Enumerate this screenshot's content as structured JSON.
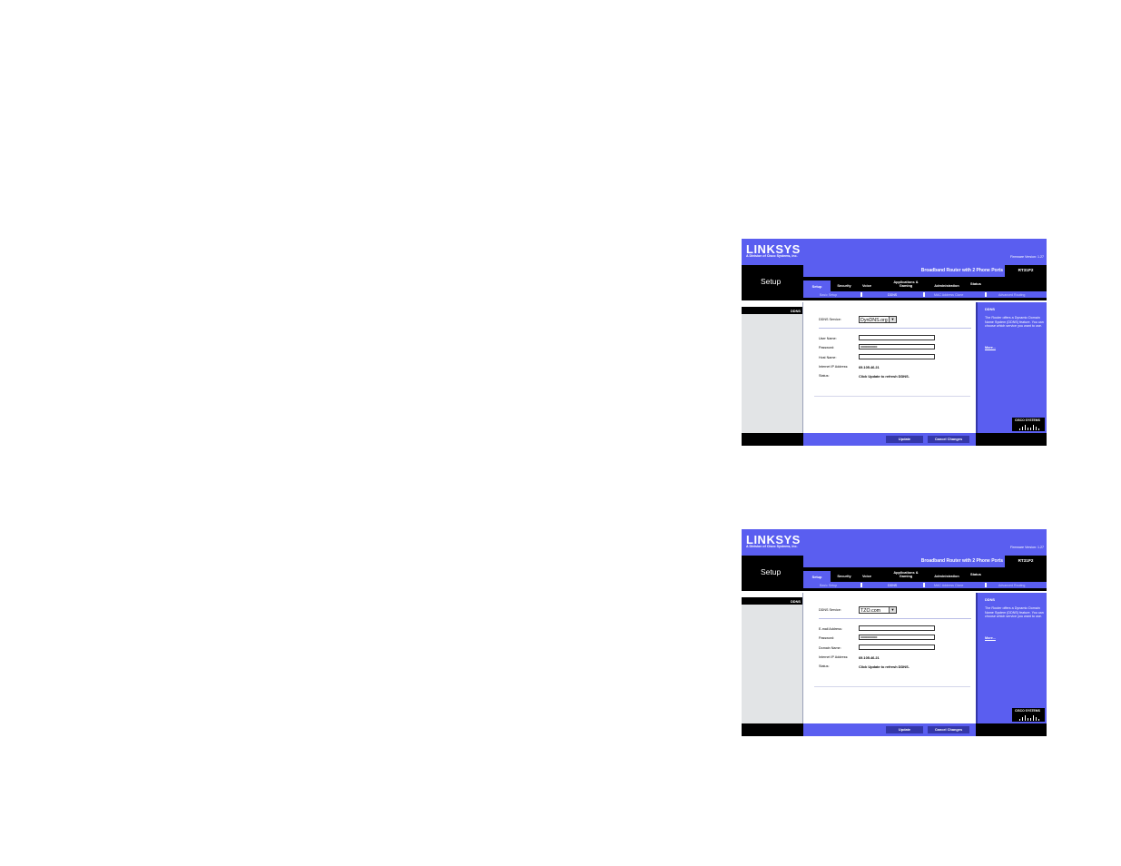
{
  "screens": [
    {
      "brand": {
        "logo": "LINKSYS",
        "tagline": "A Division of Cisco Systems, Inc."
      },
      "firmware": "Firmware Version: 1.27",
      "product_name": "Broadband Router with 2 Phone Ports",
      "model": "RT31P2",
      "page_title": "Setup",
      "tabs": [
        "Setup",
        "Security",
        "Voice",
        "Applications & Gaming",
        "Administration",
        "Status"
      ],
      "subtabs": [
        "Basic Setup",
        "DDNS",
        "MAC Address Clone",
        "Advanced Routing"
      ],
      "section_label": "DDNS",
      "form": {
        "ddns_service_label": "DDNS Service:",
        "ddns_service_value": "DynDNS.org",
        "field1_label": "User Name:",
        "field1_value": "",
        "password_label": "Password:",
        "password_value": "••••••••••••••••••••",
        "field3_label": "Host Name:",
        "field3_value": "",
        "ip_label": "Internet IP Address:",
        "ip_value": "69.105.46.21",
        "status_label": "Status:",
        "status_value": "Click Update to refresh DDNS."
      },
      "help": {
        "title": "DDNS",
        "text": "The Router offers a Dynamic Domain Name System (DDNS) feature. You can choose which service you want to use.",
        "more": "More..."
      },
      "cisco": "CISCO SYSTEMS",
      "buttons": {
        "update": "Update",
        "cancel": "Cancel Changes"
      }
    },
    {
      "brand": {
        "logo": "LINKSYS",
        "tagline": "A Division of Cisco Systems, Inc."
      },
      "firmware": "Firmware Version: 1.27",
      "product_name": "Broadband Router with 2 Phone Ports",
      "model": "RT31P2",
      "page_title": "Setup",
      "tabs": [
        "Setup",
        "Security",
        "Voice",
        "Applications & Gaming",
        "Administration",
        "Status"
      ],
      "subtabs": [
        "Basic Setup",
        "DDNS",
        "MAC Address Clone",
        "Advanced Routing"
      ],
      "section_label": "DDNS",
      "form": {
        "ddns_service_label": "DDNS Service:",
        "ddns_service_value": "TZO.com",
        "field1_label": "E-mail Address:",
        "field1_value": "",
        "password_label": "Password:",
        "password_value": "••••••••••••••••••••",
        "field3_label": "Domain Name:",
        "field3_value": "",
        "ip_label": "Internet IP Address:",
        "ip_value": "69.105.46.21",
        "status_label": "Status:",
        "status_value": "Click Update to refresh DDNS."
      },
      "help": {
        "title": "DDNS",
        "text": "The Router offers a Dynamic Domain Name System (DDNS) feature. You can choose which service you want to use.",
        "more": "More..."
      },
      "cisco": "CISCO SYSTEMS",
      "buttons": {
        "update": "Update",
        "cancel": "Cancel Changes"
      }
    }
  ],
  "colors": {
    "accent": "#5a5ef0",
    "dark": "#000000",
    "button": "#3437a8",
    "panel": "#e2e4e6"
  }
}
